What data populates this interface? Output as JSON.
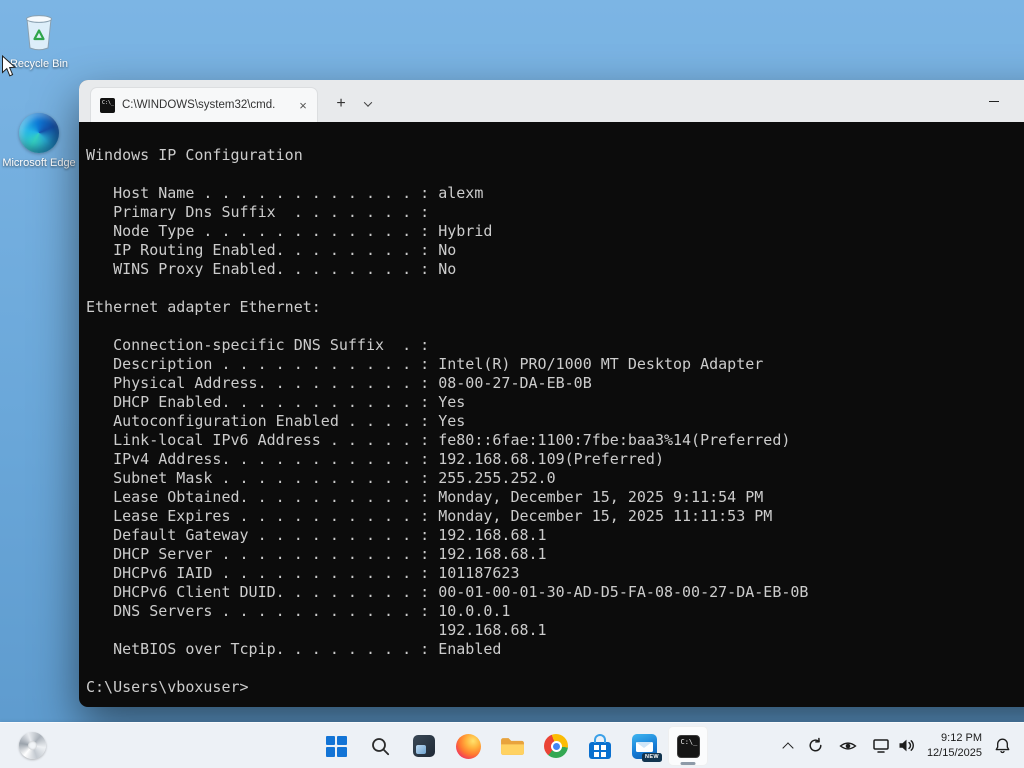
{
  "desktop": {
    "icons": [
      {
        "label": "Recycle Bin"
      },
      {
        "label": "Microsoft Edge"
      }
    ]
  },
  "window": {
    "tab_title": "C:\\WINDOWS\\system32\\cmd.",
    "cmd_icon_text": "C:\\_",
    "glyphs": {
      "close": "×",
      "new_tab": "+"
    }
  },
  "terminal": {
    "lines": [
      "Windows IP Configuration",
      "",
      "   Host Name . . . . . . . . . . . . : alexm",
      "   Primary Dns Suffix  . . . . . . . :",
      "   Node Type . . . . . . . . . . . . : Hybrid",
      "   IP Routing Enabled. . . . . . . . : No",
      "   WINS Proxy Enabled. . . . . . . . : No",
      "",
      "Ethernet adapter Ethernet:",
      "",
      "   Connection-specific DNS Suffix  . :",
      "   Description . . . . . . . . . . . : Intel(R) PRO/1000 MT Desktop Adapter",
      "   Physical Address. . . . . . . . . : 08-00-27-DA-EB-0B",
      "   DHCP Enabled. . . . . . . . . . . : Yes",
      "   Autoconfiguration Enabled . . . . : Yes",
      "   Link-local IPv6 Address . . . . . : fe80::6fae:1100:7fbe:baa3%14(Preferred)",
      "   IPv4 Address. . . . . . . . . . . : 192.168.68.109(Preferred)",
      "   Subnet Mask . . . . . . . . . . . : 255.255.252.0",
      "   Lease Obtained. . . . . . . . . . : Monday, December 15, 2025 9:11:54 PM",
      "   Lease Expires . . . . . . . . . . : Monday, December 15, 2025 11:11:53 PM",
      "   Default Gateway . . . . . . . . . : 192.168.68.1",
      "   DHCP Server . . . . . . . . . . . : 192.168.68.1",
      "   DHCPv6 IAID . . . . . . . . . . . : 101187623",
      "   DHCPv6 Client DUID. . . . . . . . : 00-01-00-01-30-AD-D5-FA-08-00-27-DA-EB-0B",
      "   DNS Servers . . . . . . . . . . . : 10.0.0.1",
      "                                       192.168.68.1",
      "   NetBIOS over Tcpip. . . . . . . . : Enabled",
      "",
      "C:\\Users\\vboxuser>"
    ]
  },
  "taskbar": {
    "outlook_badge": "NEW",
    "clock": {
      "time": "9:12 PM",
      "date": "12/15/2025"
    }
  }
}
